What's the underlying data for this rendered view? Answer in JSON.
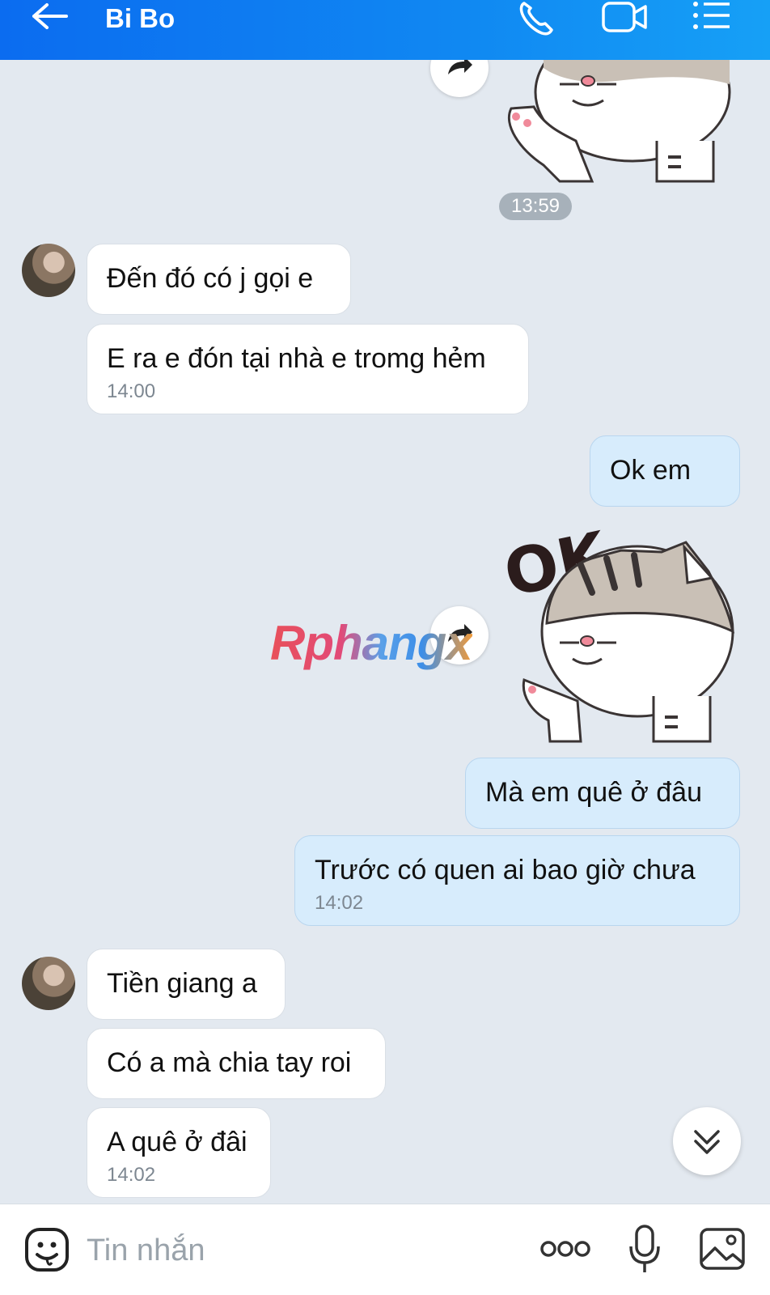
{
  "header": {
    "title": "Bi Bo",
    "accent_color": "#0b6cf0",
    "icons": [
      "back-arrow-icon",
      "phone-icon",
      "video-call-icon",
      "menu-list-icon"
    ]
  },
  "chat": {
    "time_separator": "13:59",
    "messages": [
      {
        "direction": "in",
        "text": "Đến đó có j gọi e",
        "time": ""
      },
      {
        "direction": "in",
        "text": "E ra e đón tại nhà e tromg hẻm",
        "time": "14:00"
      },
      {
        "direction": "out",
        "text": "Ok em",
        "time": ""
      },
      {
        "direction": "out",
        "text": "Mà em quê ở đâu",
        "time": ""
      },
      {
        "direction": "out",
        "text": "Trước có quen ai bao giờ chưa",
        "time": "14:02"
      },
      {
        "direction": "in",
        "text": "Tiền giang a",
        "time": ""
      },
      {
        "direction": "in",
        "text": "Có a mà chia tay roi",
        "time": ""
      },
      {
        "direction": "in",
        "text": "A quê ở đâi",
        "time": "14:02"
      }
    ],
    "stickers": [
      {
        "name": "cat-wave-sticker",
        "text": ""
      },
      {
        "name": "cat-ok-sticker",
        "text": "OK"
      }
    ],
    "watermark": "Rphangx"
  },
  "input": {
    "placeholder": "Tin nhắn",
    "icons": [
      "emoji-icon",
      "more-options-icon",
      "microphone-icon",
      "image-icon"
    ]
  }
}
